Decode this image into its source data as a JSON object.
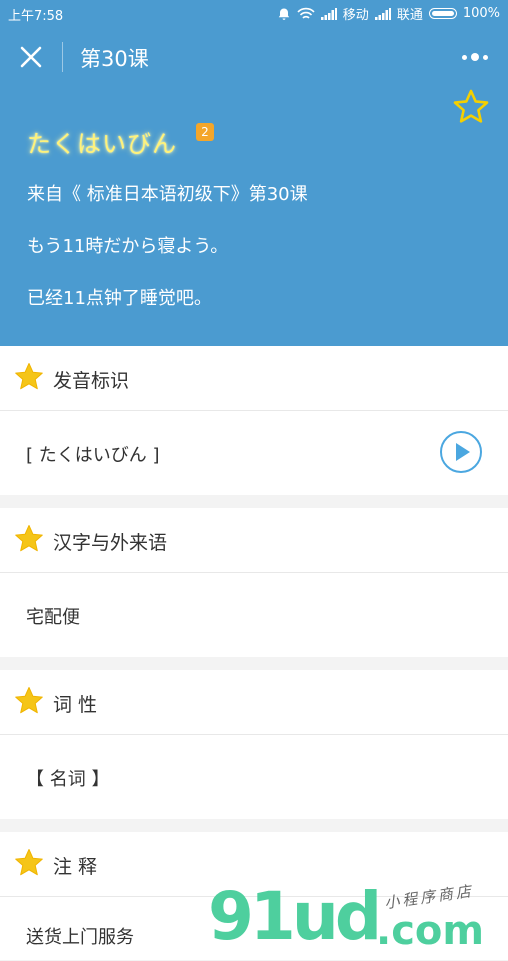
{
  "status_bar": {
    "time": "上午7:58",
    "carrier1": "移动",
    "carrier2": "联通",
    "battery": "100%"
  },
  "nav": {
    "title": "第30课"
  },
  "word": {
    "kana": "たくはいびん",
    "badge": "2",
    "source": "来自《 标准日本语初级下》第30课",
    "example_jp": "もう11時だから寝よう。",
    "example_cn": "已经11点钟了睡觉吧。"
  },
  "sections": [
    {
      "title": "发音标识",
      "content": "[ たくはいびん ]"
    },
    {
      "title": "汉字与外来语",
      "content": "宅配便"
    },
    {
      "title": "词 性",
      "content": "【  名词 】"
    },
    {
      "title": "注 释",
      "content": "送货上门服务"
    }
  ],
  "watermark": {
    "main": "91ud",
    "domain": ".com",
    "small": "小程序商店"
  },
  "colors": {
    "header_bg": "#4b9bd0",
    "star": "#f5c518",
    "play": "#4ba7e0",
    "watermark": "#4ecf9e"
  }
}
